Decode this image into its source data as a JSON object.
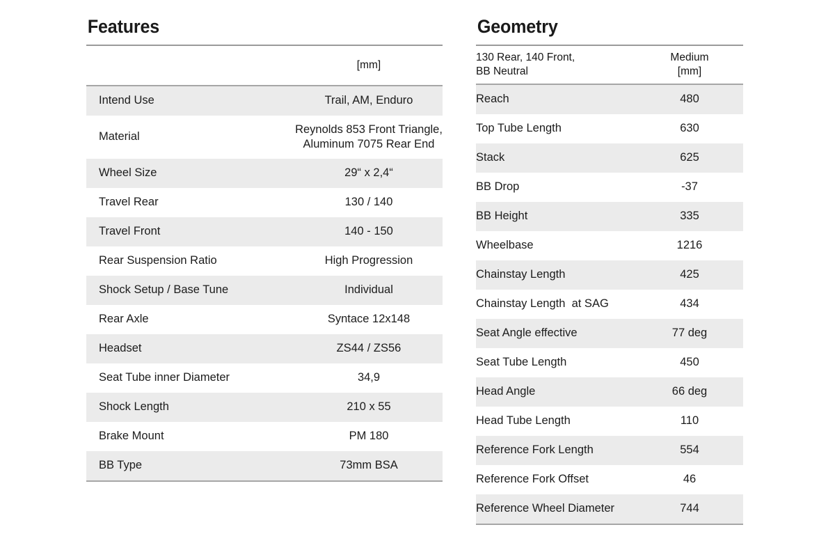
{
  "features": {
    "title": "Features",
    "column_header": {
      "label": "",
      "unit": "[mm]"
    },
    "rows": [
      {
        "label": "Intend Use",
        "value": [
          "Trail, AM, Enduro"
        ]
      },
      {
        "label": "Material",
        "value": [
          "Reynolds 853 Front Triangle,",
          "Aluminum 7075 Rear End"
        ]
      },
      {
        "label": "Wheel Size",
        "value": [
          "29“ x 2,4“"
        ]
      },
      {
        "label": "Travel Rear",
        "value": [
          "130 / 140"
        ]
      },
      {
        "label": "Travel Front",
        "value": [
          "140 - 150"
        ]
      },
      {
        "label": "Rear Suspension Ratio",
        "value": [
          "High Progression"
        ]
      },
      {
        "label": "Shock Setup / Base Tune",
        "value": [
          "Individual"
        ]
      },
      {
        "label": "Rear Axle",
        "value": [
          "Syntace 12x148"
        ]
      },
      {
        "label": "Headset",
        "value": [
          "ZS44 / ZS56"
        ]
      },
      {
        "label": "Seat Tube inner Diameter",
        "value": [
          "34,9"
        ]
      },
      {
        "label": "Shock Length",
        "value": [
          "210 x 55"
        ]
      },
      {
        "label": "Brake Mount",
        "value": [
          "PM 180"
        ]
      },
      {
        "label": "BB Type",
        "value": [
          "73mm BSA"
        ]
      }
    ]
  },
  "geometry": {
    "title": "Geometry",
    "column_header": {
      "label_line1": "130 Rear, 140 Front,",
      "label_line2": "BB Neutral",
      "size_line1": "Medium",
      "size_line2": "[mm]"
    },
    "rows": [
      {
        "label": "Reach",
        "value": "480"
      },
      {
        "label": "Top Tube Length",
        "value": "630"
      },
      {
        "label": "Stack",
        "value": "625"
      },
      {
        "label": "BB Drop",
        "value": "-37"
      },
      {
        "label": "BB Height",
        "value": "335"
      },
      {
        "label": "Wheelbase",
        "value": "1216"
      },
      {
        "label": "Chainstay Length",
        "value": "425"
      },
      {
        "label": "Chainstay Length  at SAG",
        "value": "434"
      },
      {
        "label": "Seat Angle effective",
        "value": "77 deg"
      },
      {
        "label": "Seat Tube Length",
        "value": "450"
      },
      {
        "label": "Head Angle",
        "value": "66 deg"
      },
      {
        "label": "Head Tube Length",
        "value": "110"
      },
      {
        "label": "Reference Fork Length",
        "value": "554"
      },
      {
        "label": "Reference Fork Offset",
        "value": "46"
      },
      {
        "label": "Reference Wheel Diameter",
        "value": "744"
      }
    ]
  },
  "style": {
    "page_background": "#ffffff",
    "row_shade": "#ebebeb",
    "rule_color": "#9a9a9a",
    "text_color": "#1c1c1c"
  }
}
